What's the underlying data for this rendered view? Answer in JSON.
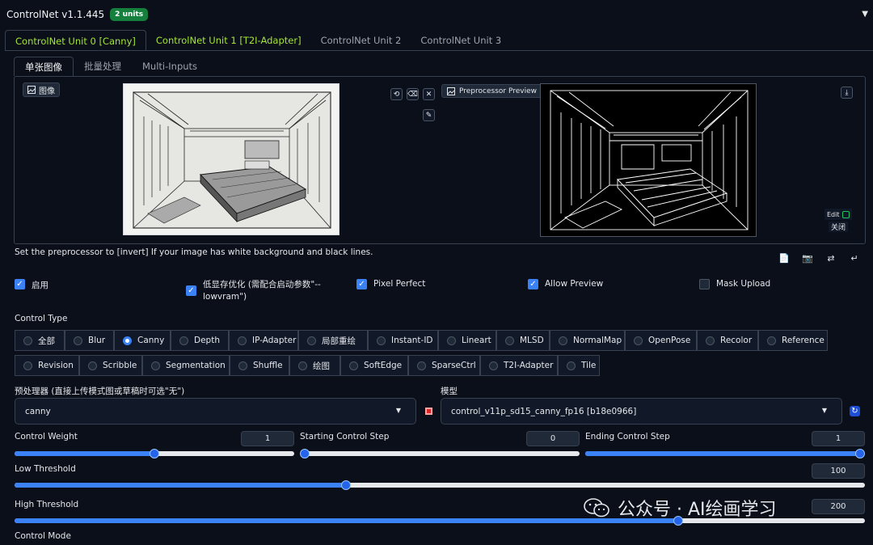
{
  "header": {
    "title": "ControlNet v1.1.445",
    "badge": "2 units"
  },
  "unit_tabs": [
    "ControlNet Unit 0 [Canny]",
    "ControlNet Unit 1 [T2I-Adapter]",
    "ControlNet Unit 2",
    "ControlNet Unit 3"
  ],
  "image_tabs": [
    "单张图像",
    "批量处理",
    "Multi-Inputs"
  ],
  "image_panel": {
    "image_label": "图像",
    "preview_label": "Preprocessor Preview",
    "edit_label": "Edit",
    "close_label": "关闭"
  },
  "note": "Set the preprocessor to [invert] If your image has white background and black lines.",
  "checks": {
    "enable": {
      "label": "启用",
      "checked": true
    },
    "lowvram": {
      "label1": "低显存优化 (需配合启动参数\"--",
      "label2": "lowvram\")",
      "checked": true
    },
    "pixel_perfect": {
      "label": "Pixel Perfect",
      "checked": true
    },
    "allow_preview": {
      "label": "Allow Preview",
      "checked": true
    },
    "mask_upload": {
      "label": "Mask Upload",
      "checked": false
    }
  },
  "control_type": {
    "label": "Control Type",
    "row1": [
      "全部",
      "Blur",
      "Canny",
      "Depth",
      "IP-Adapter",
      "局部重绘",
      "Instant-ID",
      "Lineart",
      "MLSD",
      "NormalMap",
      "OpenPose",
      "Recolor",
      "Reference"
    ],
    "row2": [
      "Revision",
      "Scribble",
      "Segmentation",
      "Shuffle",
      "绘图",
      "SoftEdge",
      "SparseCtrl",
      "T2I-Adapter",
      "Tile"
    ],
    "selected": "Canny"
  },
  "preprocessor": {
    "label": "预处理器 (直接上传模式图或草稿时可选\"无\")",
    "value": "canny"
  },
  "model": {
    "label": "模型",
    "value": "control_v11p_sd15_canny_fp16 [b18e0966]"
  },
  "sliders": {
    "control_weight": {
      "label": "Control Weight",
      "value": "1",
      "fraction": 0.5
    },
    "starting_step": {
      "label": "Starting Control Step",
      "value": "0",
      "fraction": 0.0
    },
    "ending_step": {
      "label": "Ending Control Step",
      "value": "1",
      "fraction": 1.0
    },
    "low_threshold": {
      "label": "Low Threshold",
      "value": "100",
      "fraction": 0.39
    },
    "high_threshold": {
      "label": "High Threshold",
      "value": "200",
      "fraction": 0.78
    }
  },
  "control_mode_label": "Control Mode",
  "watermark": "公众号 · AI绘画学习",
  "colors": {
    "accent": "#3b82f6",
    "tab_active": "#a3e635",
    "badge": "#15803d",
    "background": "#0b0f19"
  }
}
